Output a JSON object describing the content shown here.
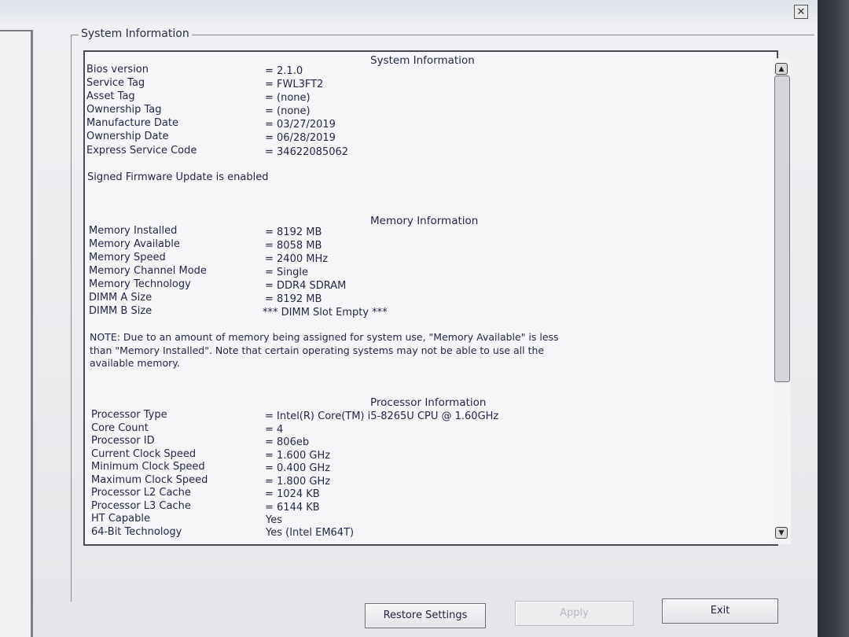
{
  "window": {
    "close_glyph": "✕"
  },
  "group_title": "System Information",
  "sections": {
    "system": {
      "title": "System Information",
      "rows": [
        {
          "label": "Bios version",
          "value": "= 2.1.0"
        },
        {
          "label": "Service Tag",
          "value": "= FWL3FT2"
        },
        {
          "label": "Asset Tag",
          "value": "= (none)"
        },
        {
          "label": "Ownership Tag",
          "value": "= (none)"
        },
        {
          "label": "Manufacture Date",
          "value": "= 03/27/2019"
        },
        {
          "label": "Ownership Date",
          "value": "= 06/28/2019"
        },
        {
          "label": "Express Service Code",
          "value": "= 34622085062"
        }
      ],
      "firmware_note": "Signed Firmware Update is enabled"
    },
    "memory": {
      "title": "Memory Information",
      "rows": [
        {
          "label": "Memory Installed",
          "value": "= 8192 MB"
        },
        {
          "label": "Memory Available",
          "value": "= 8058 MB"
        },
        {
          "label": "Memory Speed",
          "value": "= 2400 MHz"
        },
        {
          "label": "Memory Channel Mode",
          "value": "= Single"
        },
        {
          "label": "Memory Technology",
          "value": "= DDR4 SDRAM"
        },
        {
          "label": "DIMM A Size",
          "value": "= 8192 MB"
        },
        {
          "label": "DIMM B Size",
          "value": "*** DIMM Slot Empty ***"
        }
      ],
      "note_line1": "NOTE: Due to an amount of memory being assigned for system use, \"Memory Available\" is less",
      "note_line2": "than \"Memory Installed\". Note that certain operating systems may not be able to use all the",
      "note_line3": "available memory."
    },
    "processor": {
      "title": "Processor Information",
      "rows": [
        {
          "label": "Processor Type",
          "value": "= Intel(R) Core(TM) i5-8265U CPU @ 1.60GHz"
        },
        {
          "label": "Core Count",
          "value": "= 4"
        },
        {
          "label": "Processor ID",
          "value": "= 806eb"
        },
        {
          "label": "Current Clock Speed",
          "value": "= 1.600 GHz"
        },
        {
          "label": "Minimum Clock Speed",
          "value": "= 0.400 GHz"
        },
        {
          "label": "Maximum Clock Speed",
          "value": "= 1.800 GHz"
        },
        {
          "label": "Processor L2 Cache",
          "value": "= 1024 KB"
        },
        {
          "label": "Processor L3 Cache",
          "value": "= 6144 KB"
        },
        {
          "label": "HT Capable",
          "value": "Yes"
        },
        {
          "label": "64-Bit Technology",
          "value": "Yes (Intel EM64T)"
        }
      ]
    }
  },
  "buttons": {
    "restore": "Restore Settings",
    "apply": "Apply",
    "exit": "Exit"
  },
  "icons": {
    "scroll_up": "▲",
    "scroll_down": "▼"
  }
}
